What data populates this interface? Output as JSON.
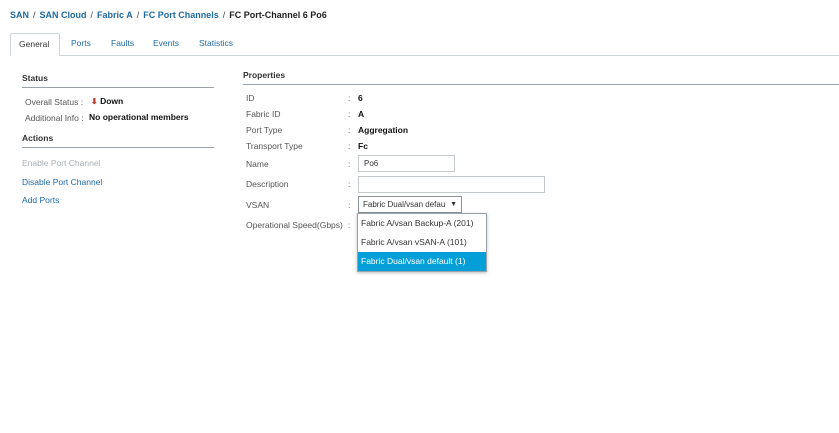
{
  "breadcrumb": {
    "items": [
      "SAN",
      "SAN Cloud",
      "Fabric A",
      "FC Port Channels"
    ],
    "current": "FC Port-Channel 6 Po6",
    "separator": "/"
  },
  "tabs": [
    {
      "label": "General",
      "active": true
    },
    {
      "label": "Ports"
    },
    {
      "label": "Faults"
    },
    {
      "label": "Events"
    },
    {
      "label": "Statistics"
    }
  ],
  "status": {
    "heading": "Status",
    "overall_label": "Overall Status",
    "overall_value": "Down",
    "additional_label": "Additional Info",
    "additional_value": "No operational members"
  },
  "actions": {
    "heading": "Actions",
    "items": [
      {
        "label": "Enable Port Channel",
        "enabled": false
      },
      {
        "label": "Disable Port Channel",
        "enabled": true
      },
      {
        "label": "Add Ports",
        "enabled": true
      }
    ]
  },
  "properties": {
    "heading": "Properties",
    "id_label": "ID",
    "id_value": "6",
    "fabric_label": "Fabric ID",
    "fabric_value": "A",
    "port_type_label": "Port Type",
    "port_type_value": "Aggregation",
    "transport_label": "Transport Type",
    "transport_value": "Fc",
    "name_label": "Name",
    "name_value": "Po6",
    "description_label": "Description",
    "description_value": "",
    "vsan_label": "VSAN",
    "vsan_selected": "Fabric Dual/vsan defau",
    "speed_label": "Operational Speed(Gbps)",
    "vsan_options": [
      {
        "label": "Fabric A/vsan Backup-A (201)"
      },
      {
        "label": "Fabric A/vsan vSAN-A (101)"
      },
      {
        "label": "Fabric Dual/vsan default (1)",
        "selected": true
      }
    ]
  },
  "colors": {
    "link": "#1f6aa5",
    "selected_option": "#049fd9",
    "status_down": "#c0392b"
  }
}
